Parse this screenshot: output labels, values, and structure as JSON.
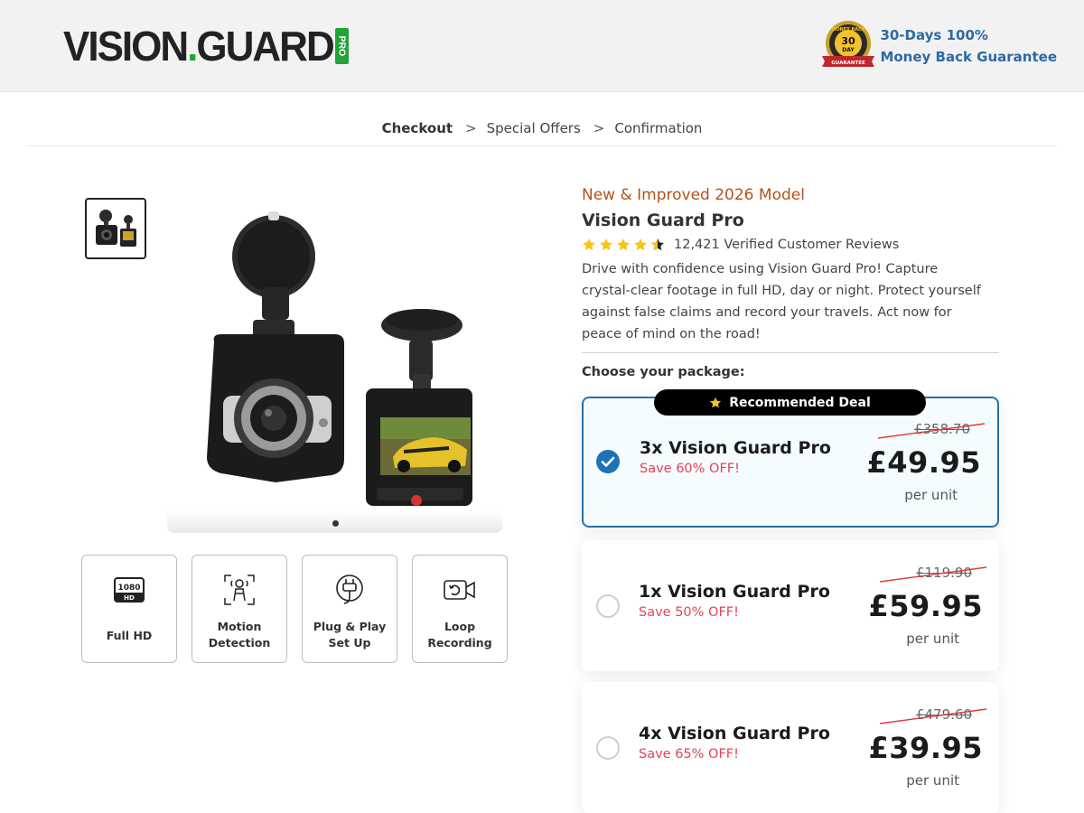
{
  "brand": {
    "logo_main": "VISION",
    "logo_dot": ".",
    "logo_second": "GUARD",
    "logo_pro": "PRO"
  },
  "guarantee": {
    "badge_text_top": "MONEY BACK",
    "badge_text_days": "30",
    "badge_text_day": "DAY",
    "badge_ribbon": "GUARANTEE",
    "line1": "30-Days 100%",
    "line2": "Money Back Guarantee"
  },
  "breadcrumb": {
    "items": [
      "Checkout",
      "Special Offers",
      "Confirmation"
    ],
    "separator": ">",
    "active_index": 0
  },
  "gallery": {
    "active_dot": 1,
    "dot_count": 1
  },
  "features": [
    {
      "icon": "1080-hd-icon",
      "icon_text": "1080",
      "icon_subtext": "HD",
      "label": "Full HD"
    },
    {
      "icon": "motion-detection-icon",
      "label": "Motion Detection"
    },
    {
      "icon": "plug-icon",
      "label": "Plug & Play Set Up"
    },
    {
      "icon": "loop-camera-icon",
      "label": "Loop Recording"
    }
  ],
  "product": {
    "tagline": "New & Improved 2026 Model",
    "title": "Vision Guard Pro",
    "rating_stars": 4.5,
    "reviews": "12,421 Verified Customer Reviews",
    "description": "Drive with confidence using Vision Guard Pro! Capture crystal-clear footage in full HD, day or night. Protect yourself against false claims and record your travels. Act now for peace of mind on the road!",
    "choose_label": "Choose your package:"
  },
  "packages": [
    {
      "name": "3x Vision Guard Pro",
      "save": "Save 60% OFF!",
      "old_price": "£358.70",
      "price": "£49.95",
      "unit": "per unit",
      "selected": true,
      "badge": "Recommended Deal"
    },
    {
      "name": "1x Vision Guard Pro",
      "save": "Save 50% OFF!",
      "old_price": "£119.90",
      "price": "£59.95",
      "unit": "per unit",
      "selected": false
    },
    {
      "name": "4x Vision Guard Pro",
      "save": "Save 65% OFF!",
      "old_price": "£479.60",
      "price": "£39.95",
      "unit": "per unit",
      "selected": false
    }
  ],
  "colors": {
    "accent_blue": "#2a6fa8",
    "tagline": "#b5521b",
    "save_red": "#e8415a",
    "star_yellow": "#f5c518",
    "brand_green": "#22a33a"
  }
}
